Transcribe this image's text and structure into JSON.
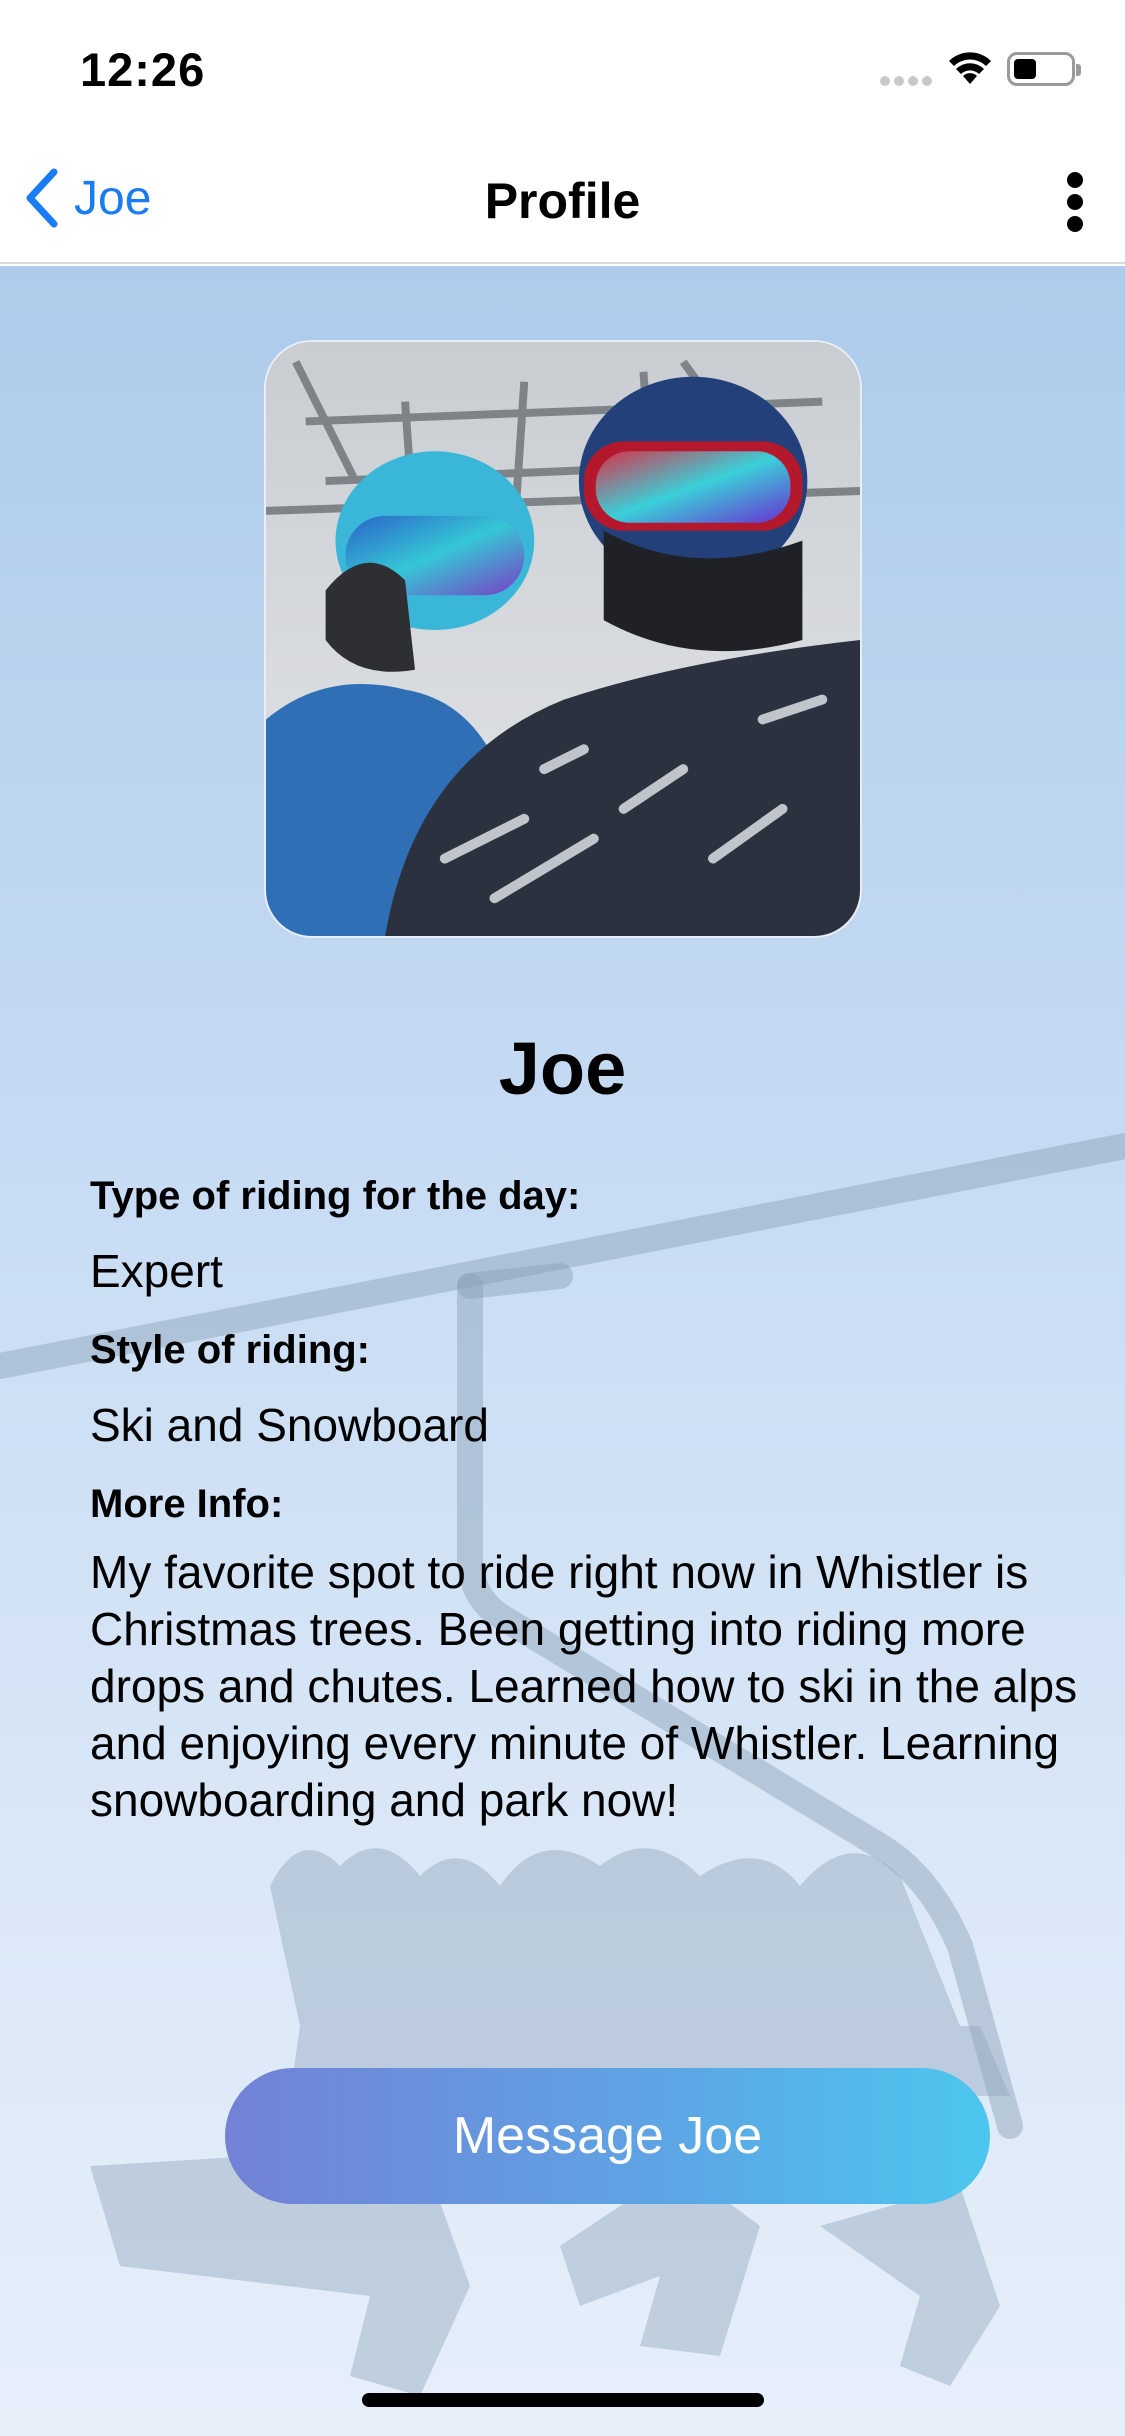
{
  "status_bar": {
    "time": "12:26",
    "icons": [
      "cellular-signal-icon",
      "wifi-icon",
      "battery-icon"
    ]
  },
  "nav": {
    "back_label": "Joe",
    "title": "Profile",
    "back_icon": "chevron-left-icon",
    "more_icon": "more-vertical-icon"
  },
  "profile": {
    "photo": "profile-photo",
    "name": "Joe",
    "riding_type_label": "Type of riding for the day:",
    "riding_type_value": "Expert",
    "style_label": "Style of riding:",
    "style_value": "Ski and Snowboard",
    "more_info_label": "More Info:",
    "more_info_text": "My favorite spot to ride right now in Whistler is Christmas trees.  Been getting into riding more drops and chutes.  Learned how to ski in the alps and enjoying every minute of Whistler. Learning snowboarding and park now!"
  },
  "actions": {
    "message_button": "Message Joe"
  },
  "colors": {
    "accent": "#1a7cf2",
    "button_gradient_start": "#7381d6",
    "button_gradient_end": "#4cc7ee",
    "background_top": "#aecbeb",
    "background_bottom": "#e6effa"
  }
}
